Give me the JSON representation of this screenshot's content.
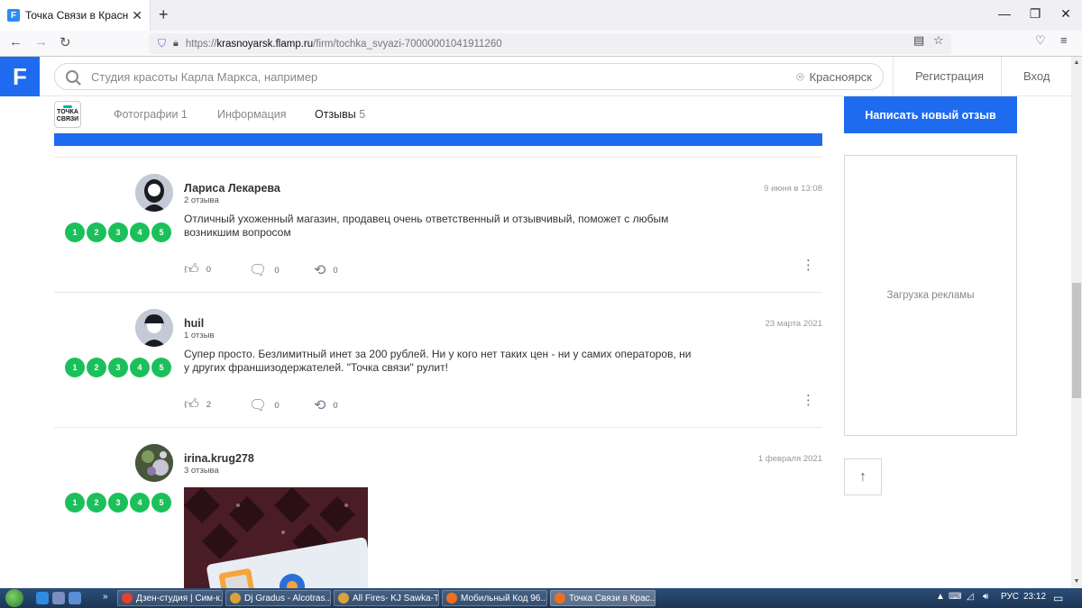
{
  "browser": {
    "tab_title": "Точка Связи в Красноярске на",
    "url_prefix": "https://",
    "url_host": "krasnoyarsk.flamp.ru",
    "url_path": "/firm/tochka_svyazi-70000001041911260"
  },
  "header": {
    "logo": "F",
    "search_placeholder": "Студия красоты Карла Маркса, например",
    "city": "Красноярск",
    "register": "Регистрация",
    "login": "Вход"
  },
  "company": {
    "logo_line1": "ТОЧКА",
    "logo_line2": "СВЯЗИ",
    "tabs": [
      {
        "label": "Фотографии",
        "count": "1"
      },
      {
        "label": "Информация",
        "count": ""
      },
      {
        "label": "Отзывы",
        "count": "5"
      }
    ],
    "write_review": "Написать новый отзыв"
  },
  "rating_steps": [
    "1",
    "2",
    "3",
    "4",
    "5"
  ],
  "reviews": [
    {
      "author": "Лариса Лекарева",
      "reviews_count": "2 отзыва",
      "date": "9 июня в 13:08",
      "text": "Отличный ухоженный магазин, продавец очень ответственный и отзывчивый, поможет с любым возникшим вопросом",
      "likes": "0",
      "comments": "0",
      "shares": "0"
    },
    {
      "author": "huil",
      "reviews_count": "1 отзыв",
      "date": "23 марта 2021",
      "text": "Супер просто. Безлимитный инет за 200 рублей. Ни у кого нет таких цен - ни у самих операторов, ни у других франшизодержателей. \"Точка связи\" рулит!",
      "likes": "2",
      "comments": "0",
      "shares": "0"
    },
    {
      "author": "irina.krug278",
      "reviews_count": "3 отзыва",
      "date": "1 февраля 2021"
    }
  ],
  "sidebar": {
    "ad_loading": "Загрузка рекламы"
  },
  "taskbar": {
    "items": [
      "Дзен-студия | Сим-к...",
      "Dj Gradus - Alcotras...",
      "All Fires- KJ Sawka-T...",
      "Мобильный Код 96...",
      "Точка Связи в Крас..."
    ],
    "lang": "РУС",
    "time": "23:12"
  }
}
